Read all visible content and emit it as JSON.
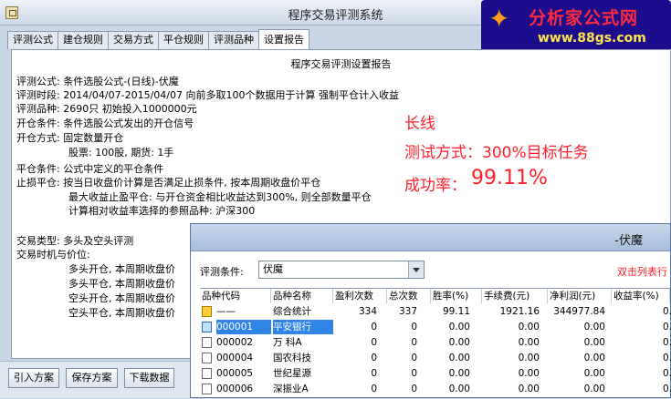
{
  "window": {
    "title": "程序交易评测系统"
  },
  "logo": {
    "name": "分析家公式网",
    "url": "www.88gs.com"
  },
  "tabs": [
    "评测公式",
    "建仓规则",
    "交易方式",
    "平仓规则",
    "评测品种",
    "设置报告"
  ],
  "report": {
    "title": "程序交易评测设置报告",
    "lines": [
      "评测公式: 条件选股公式-(日线)-伏魔",
      "评测时段: 2014/04/07-2015/04/07  向前多取100个数据用于计算  强制平仓计入收益",
      "评测品种: 2690只  初始投入1000000元",
      "开仓条件: 条件选股公式发出的开仓信号",
      "开仓方式: 固定数量开仓",
      "          股票: 100股, 期货: 1手",
      "平仓条件: 公式中定义的平仓条件",
      "止损平仓: 按当日收盘价计算是否满足止损条件, 按本周期收盘价平仓",
      "          最大收益止盈平仓: 与开仓资金相比收益达到300%, 则全部数量平仓",
      "          计算相对收益率选择的参照品种: 沪深300",
      "交易类型: 多头及空头评测",
      "交易时机与价位:",
      "          多头开仓, 本周期收盘价",
      "          多头平仓, 本周期收盘价",
      "          空头开仓, 本周期收盘价",
      "          空头平仓, 本周期收盘价"
    ]
  },
  "annotations": {
    "line1": "长线",
    "line2": "测试方式：300%目标任务",
    "line3_label": "成功率：",
    "line3_value": "99.11%"
  },
  "buttons": [
    "引入方案",
    "保存方案",
    "下载数据"
  ],
  "popup": {
    "title": "-伏魔",
    "filter_label": "评测条件:",
    "filter_value": "伏魔",
    "hint": "双击列表行",
    "columns": [
      "品种代码",
      "品种名称",
      "盈利次数",
      "总次数",
      "胜率(%)",
      "手续费(元)",
      "净利润(元)",
      "收益率(%)"
    ],
    "rows": [
      [
        "——",
        "综合统计",
        "334",
        "337",
        "99.11",
        "1921.16",
        "344977.84",
        "0."
      ],
      [
        "000001",
        "平安银行",
        "0",
        "0",
        "0.00",
        "0.00",
        "0.00",
        "0."
      ],
      [
        "000002",
        "万  科A",
        "0",
        "0",
        "0.00",
        "0.00",
        "0.00",
        "0."
      ],
      [
        "000004",
        "国农科技",
        "0",
        "0",
        "0.00",
        "0.00",
        "0.00",
        "0."
      ],
      [
        "000005",
        "世纪星源",
        "0",
        "0",
        "0.00",
        "0.00",
        "0.00",
        "0."
      ],
      [
        "000006",
        "深振业A",
        "0",
        "0",
        "0.00",
        "0.00",
        "0.00",
        "0."
      ]
    ]
  }
}
